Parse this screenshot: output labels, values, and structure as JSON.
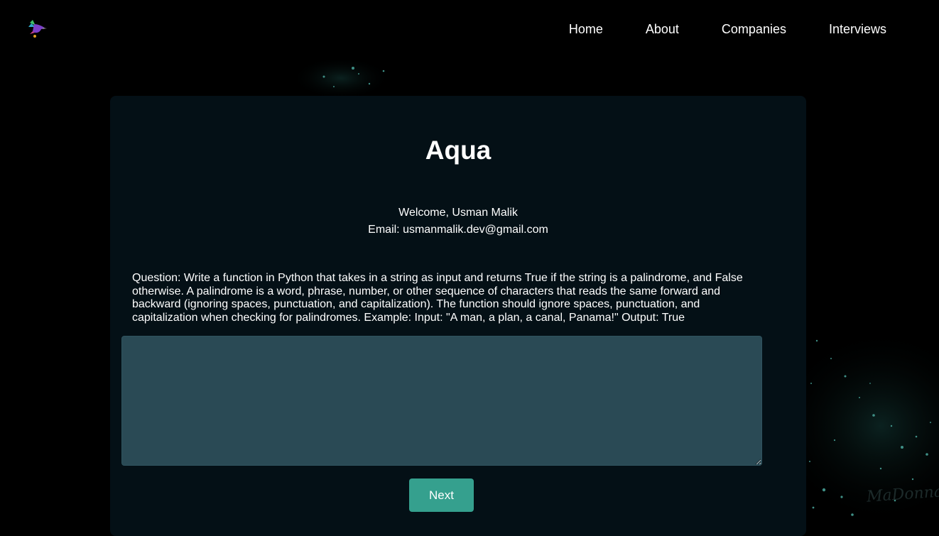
{
  "nav": {
    "items": [
      {
        "label": "Home"
      },
      {
        "label": "About"
      },
      {
        "label": "Companies"
      },
      {
        "label": "Interviews"
      }
    ]
  },
  "card": {
    "title": "Aqua",
    "welcome": "Welcome, Usman Malik",
    "email": "Email: usmanmalik.dev@gmail.com",
    "question": "Question: Write a function in Python that takes in a string as input and returns True if the string is a palindrome, and False otherwise. A palindrome is a word, phrase, number, or other sequence of characters that reads the same forward and backward (ignoring spaces, punctuation, and capitalization). The function should ignore spaces, punctuation, and capitalization when checking for palindromes. Example: Input: \"A man, a plan, a canal, Panama!\" Output: True",
    "answer_value": "",
    "next_label": "Next"
  },
  "watermark": "MaDonna",
  "colors": {
    "background": "#000000",
    "card": "#041016",
    "textarea": "#2a4a55",
    "button": "#35a08e",
    "text": "#ffffff"
  },
  "icons": {
    "logo": "hummingbird-logo-icon"
  }
}
